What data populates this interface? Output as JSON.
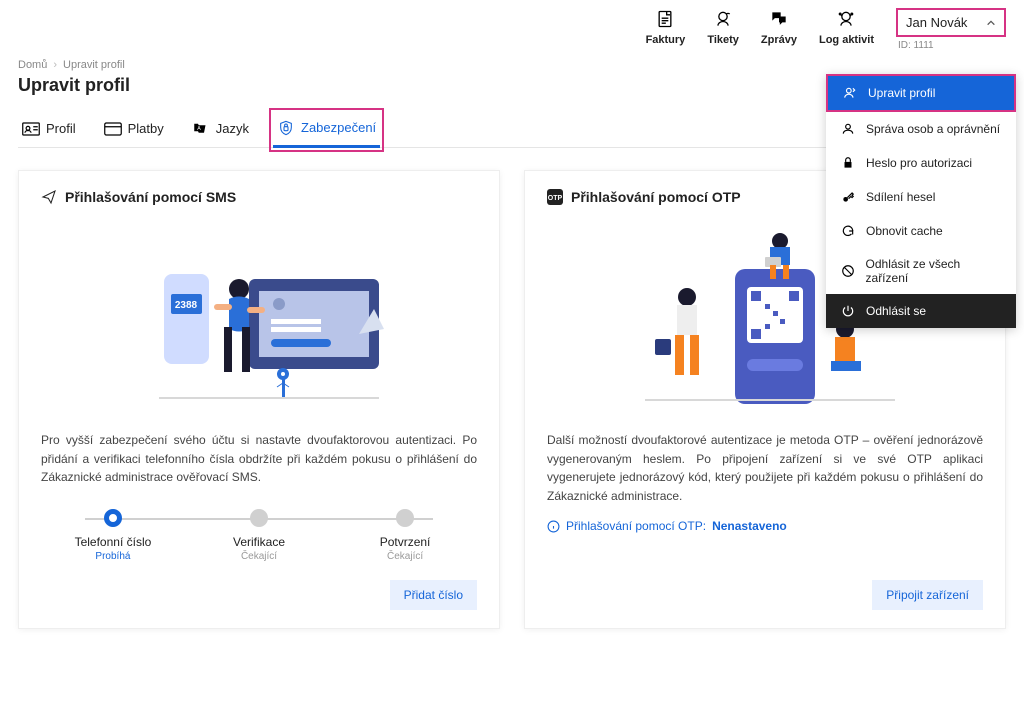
{
  "topnav": {
    "items": [
      {
        "label": "Faktury"
      },
      {
        "label": "Tikety"
      },
      {
        "label": "Zprávy"
      },
      {
        "label": "Log aktivit"
      }
    ],
    "user": {
      "name": "Jan Novák",
      "id_label": "ID: 1111"
    }
  },
  "dropdown": {
    "items": [
      {
        "label": "Upravit profil",
        "active": true
      },
      {
        "label": "Správa osob a oprávnění"
      },
      {
        "label": "Heslo pro autorizaci"
      },
      {
        "label": "Sdílení hesel"
      },
      {
        "label": "Obnovit cache"
      },
      {
        "label": "Odhlásit ze všech zařízení"
      }
    ],
    "logout": "Odhlásit se"
  },
  "breadcrumb": {
    "home": "Domů",
    "current": "Upravit profil"
  },
  "page": {
    "title": "Upravit profil"
  },
  "tabs": {
    "items": [
      {
        "label": "Profil"
      },
      {
        "label": "Platby"
      },
      {
        "label": "Jazyk"
      },
      {
        "label": "Zabezpečení",
        "active": true
      }
    ]
  },
  "card_sms": {
    "title": "Přihlašování pomocí SMS",
    "text": "Pro vyšší zabezpečení svého účtu si nastavte dvoufaktorovou autentizaci. Po přidání a verifikaci telefonního čísla obdržíte při každém pokusu o přihlášení do Zákaznické administrace ověřovací SMS.",
    "steps": [
      {
        "title": "Telefonní číslo",
        "sub": "Probíhá",
        "active": true
      },
      {
        "title": "Verifikace",
        "sub": "Čekající"
      },
      {
        "title": "Potvrzení",
        "sub": "Čekající"
      }
    ],
    "button": "Přidat číslo",
    "illu_code": "2388"
  },
  "card_otp": {
    "title": "Přihlašování pomocí OTP",
    "text": "Další možností dvoufaktorové autentizace je metoda OTP – ověření jednorázově vygenerovaným heslem. Po připojení zařízení si ve své OTP aplikaci vygenerujete jednorázový kód, který použijete při každém pokusu o přihlášení do Zákaznické administrace.",
    "status_label": "Přihlašování pomocí OTP:",
    "status_value": "Nenastaveno",
    "button": "Připojit zařízení"
  }
}
